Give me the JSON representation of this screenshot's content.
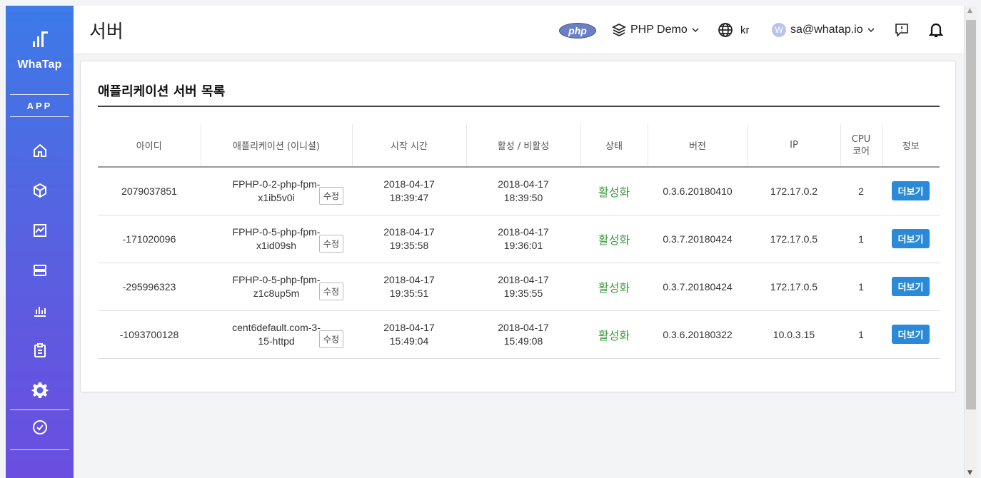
{
  "sidebar": {
    "logo_text": "WhaTap",
    "section": "APP",
    "icons": [
      "home-icon",
      "cube-icon",
      "chart-line-icon",
      "server-icon",
      "bar-chart-icon",
      "clipboard-icon",
      "gear-icon",
      "check-circle-icon"
    ]
  },
  "header": {
    "title": "서버",
    "php_badge": "php",
    "project": "PHP Demo",
    "language": "kr",
    "avatar_initial": "W",
    "user": "sa@whatap.io"
  },
  "card": {
    "title": "애플리케이션 서버 목록"
  },
  "table": {
    "headers": [
      "아이디",
      "애플리케이션 (이니셜)",
      "시작 시간",
      "활성 / 비활성",
      "상태",
      "버전",
      "IP",
      "CPU 코어",
      "정보"
    ],
    "edit_label": "수정",
    "more_label": "더보기",
    "rows": [
      {
        "id": "2079037851",
        "app": "FPHP-0-2-php-fpm-x1ib5v0i",
        "start": "2018-04-17 18:39:47",
        "active": "2018-04-17 18:39:50",
        "status": "활성화",
        "version": "0.3.6.20180410",
        "ip": "172.17.0.2",
        "cpu": "2"
      },
      {
        "id": "-171020096",
        "app": "FPHP-0-5-php-fpm-x1id09sh",
        "start": "2018-04-17 19:35:58",
        "active": "2018-04-17 19:36:01",
        "status": "활성화",
        "version": "0.3.7.20180424",
        "ip": "172.17.0.5",
        "cpu": "1"
      },
      {
        "id": "-295996323",
        "app": "FPHP-0-5-php-fpm-z1c8up5m",
        "start": "2018-04-17 19:35:51",
        "active": "2018-04-17 19:35:55",
        "status": "활성화",
        "version": "0.3.7.20180424",
        "ip": "172.17.0.5",
        "cpu": "1"
      },
      {
        "id": "-1093700128",
        "app": "cent6default.com-3-15-httpd",
        "start": "2018-04-17 15:49:04",
        "active": "2018-04-17 15:49:08",
        "status": "활성화",
        "version": "0.3.6.20180322",
        "ip": "10.0.3.15",
        "cpu": "1"
      }
    ]
  },
  "colors": {
    "sidebar_top": "#3d7ae8",
    "sidebar_bottom": "#6a4ee0",
    "status_active": "#3c9a3c",
    "more_button": "#2b8ad8"
  }
}
